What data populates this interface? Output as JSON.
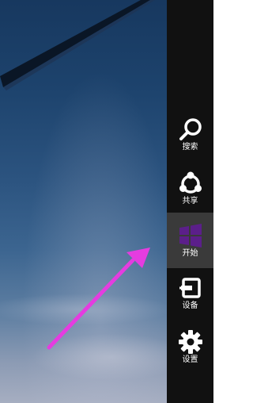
{
  "charms": [
    {
      "id": "search",
      "label": "搜索",
      "icon": "search-icon"
    },
    {
      "id": "share",
      "label": "共享",
      "icon": "share-icon"
    },
    {
      "id": "start",
      "label": "开始",
      "icon": "windows-logo-icon",
      "active": true
    },
    {
      "id": "devices",
      "label": "设备",
      "icon": "devices-icon"
    },
    {
      "id": "settings",
      "label": "设置",
      "icon": "gear-icon"
    }
  ],
  "colors": {
    "charm_bar_bg": "#111111",
    "active_charm_bg": "#3a3a3a",
    "windows_logo": "#5b1f8a",
    "arrow": "#e53ce0",
    "label_text": "#ffffff"
  }
}
